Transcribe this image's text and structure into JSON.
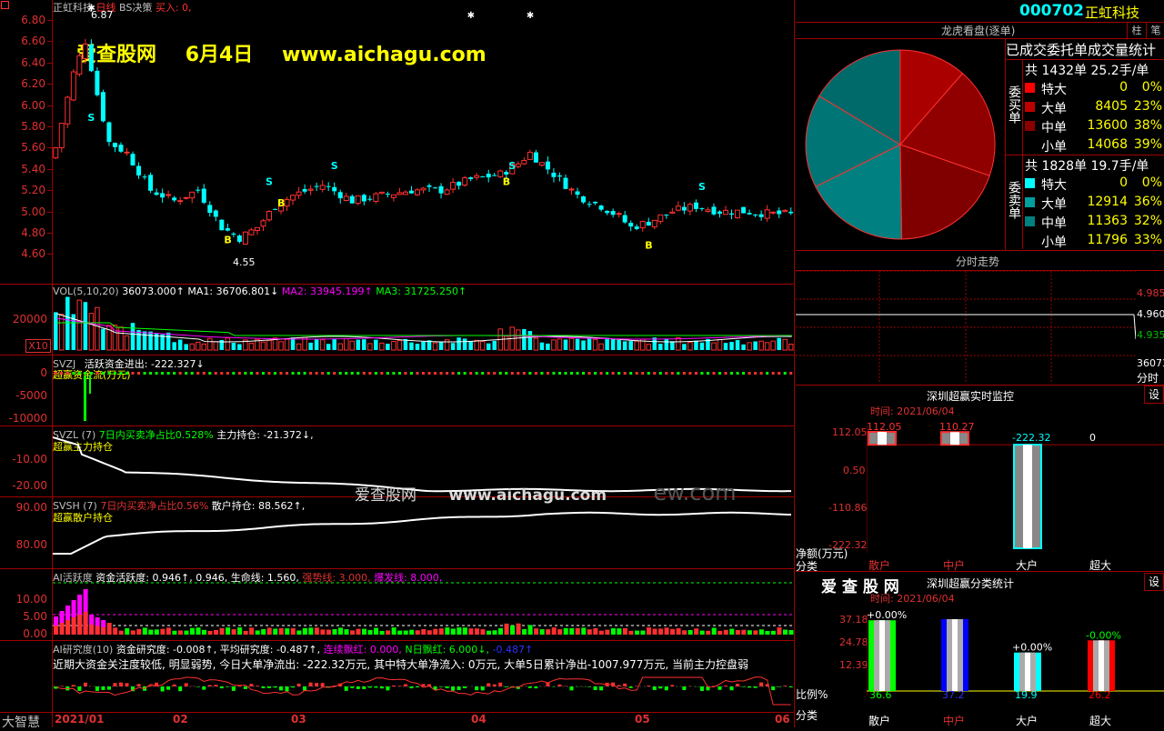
{
  "header": {
    "stock_name": "正虹科技",
    "period": "日线",
    "strategy": "BS决策",
    "signal": "买入: 0,",
    "watermark_site": "爱查股网",
    "watermark_date": "6月4日",
    "watermark_url": "www.aichagu.com"
  },
  "kline": {
    "price_ticks": [
      "6.80",
      "6.60",
      "6.40",
      "6.20",
      "6.00",
      "5.80",
      "5.60",
      "5.40",
      "5.20",
      "5.00",
      "4.80",
      "4.60"
    ],
    "high_label": "6.87",
    "low_label": "4.55"
  },
  "vol": {
    "title": "VOL(5,10,20)",
    "v": "36073.000↑",
    "ma1": "MA1: 36706.801↓",
    "ma2": "MA2: 33945.199↑",
    "ma3": "MA3: 31725.250↑",
    "tick": "20000",
    "unit": "X10"
  },
  "svzj": {
    "title": "SVZJ",
    "label": "活跃资金进出: -222.327↓",
    "sub": "超赢资金流(万元)",
    "ticks": [
      "0",
      "-5000",
      "-10000"
    ]
  },
  "svzl": {
    "title": "SVZL (7)",
    "label1": "7日内买卖净占比0.528%",
    "label2": "主力持仓: -21.372↓,",
    "sub": "超赢主力持仓",
    "ticks": [
      "-10.00",
      "-20.00"
    ],
    "wm_site": "爱查股网",
    "wm_url": "www.aichagu.com",
    "wm_ghost": "ew.com"
  },
  "svsh": {
    "title": "SVSH (7)",
    "label1": "7日内买卖净占比0.56%",
    "label2": "散户持仓: 88.562↑,",
    "sub": "超赢散户持仓",
    "ticks": [
      "90.00",
      "80.00"
    ]
  },
  "ai_active": {
    "title": "AI活跃度",
    "l1": "资金活跃度: 0.946↑,",
    "l2": "0.946,",
    "l3": "生命线: 1.560,",
    "l4": "强势线: 3.000,",
    "l5": "爆发线: 8.000,",
    "ticks": [
      "10.00",
      "5.00",
      "0.00"
    ]
  },
  "ai_research": {
    "title": "AI研究度(10)",
    "l1": "资金研究度: -0.008↑,",
    "l2": "平均研究度: -0.487↑,",
    "l3": "连续飘红: 0.000,",
    "l4": "N日飘红: 6.000↓,",
    "l5": "-0.487↑",
    "comment": "近期大资金关注度较低, 明显弱势, 今日大单净流出: -222.32万元, 其中特大单净流入: 0万元, 大单5日累计净出-1007.977万元, 当前主力控盘弱"
  },
  "xaxis": [
    "2021/01",
    "02",
    "03",
    "04",
    "05",
    "06"
  ],
  "bottom_left": "大智慧",
  "right": {
    "code": "000702",
    "name": "正虹科技",
    "btn1": "柱",
    "btn2": "笔",
    "dragon_title": "龙虎看盘(逐单)",
    "stats_title": "已成交委托单成交量统计",
    "buy_total": "共 1432单 25.2手/单",
    "sell_total": "共 1828单 19.7手/单",
    "buy_label": "委买单",
    "sell_label": "委卖单",
    "buy_rows": [
      {
        "name": "特大",
        "vol": "0",
        "pct": "0%",
        "color": "#ff0000"
      },
      {
        "name": "大单",
        "vol": "8405",
        "pct": "23%",
        "color": "#c00000"
      },
      {
        "name": "中单",
        "vol": "13600",
        "pct": "38%",
        "color": "#8c0000"
      },
      {
        "name": "小单",
        "vol": "14068",
        "pct": "39%",
        "color": "#600000"
      }
    ],
    "sell_rows": [
      {
        "name": "特大",
        "vol": "0",
        "pct": "0%",
        "color": "#00ffff"
      },
      {
        "name": "大单",
        "vol": "12914",
        "pct": "36%",
        "color": "#00a0a0"
      },
      {
        "name": "中单",
        "vol": "11363",
        "pct": "32%",
        "color": "#008080"
      },
      {
        "name": "小单",
        "vol": "11796",
        "pct": "33%",
        "color": "#006060"
      }
    ],
    "pie_slices": [
      {
        "label": "买 特大",
        "value": 0,
        "color": "#ff0000"
      },
      {
        "label": "买 大单",
        "value": 23,
        "color": "#aa0000"
      },
      {
        "label": "买 中单",
        "value": 38,
        "color": "#900000"
      },
      {
        "label": "买 小单",
        "value": 39,
        "color": "#800000"
      },
      {
        "label": "卖 特大",
        "value": 0,
        "color": "#00ffff"
      },
      {
        "label": "卖 大单",
        "value": 36,
        "color": "#008080"
      },
      {
        "label": "卖 中单",
        "value": 32,
        "color": "#007575"
      },
      {
        "label": "卖 小单",
        "value": 33,
        "color": "#006a6a"
      }
    ],
    "intraday_title": "分时走势",
    "intraday_ticks": [
      "4.985",
      "4.960",
      "4.935"
    ],
    "intraday_vol": "36073",
    "intraday_label": "分时",
    "monitor_title": "深圳超赢实时监控",
    "monitor_btn": "设",
    "monitor_time": "时间: 2021/06/04",
    "monitor_ticks": [
      "112.05",
      "0.50",
      "-110.86",
      "-222.32"
    ],
    "monitor_values": [
      "112.05",
      "110.27",
      "-222.32",
      "0"
    ],
    "monitor_unit": "净额(万元)",
    "monitor_cat_label": "分类",
    "categories": [
      "散户",
      "中户",
      "大户",
      "超大"
    ],
    "class_site": "爱 查 股 网",
    "class_title": "深圳超赢分类统计",
    "class_btn": "设",
    "class_time": "时间: 2021/06/04",
    "class_ticks": [
      "37.18",
      "24.78",
      "12.39"
    ],
    "class_changes": [
      "+0.00%",
      "",
      "+0.00%",
      "-0.00%"
    ],
    "class_values": [
      "36.6",
      "37.2",
      "19.9",
      "26.2"
    ],
    "class_ratio_label": "比例%",
    "class_cat_label": "分类",
    "chart_data": [
      {
        "type": "bar",
        "title": "深圳超赢实时监控",
        "ylabel": "净额(万元)",
        "categories": [
          "散户",
          "中户",
          "大户",
          "超大"
        ],
        "values": [
          112.05,
          110.27,
          -222.32,
          0
        ],
        "ylim": [
          -222.32,
          112.05
        ]
      },
      {
        "type": "bar",
        "title": "深圳超赢分类统计",
        "ylabel": "比例%",
        "categories": [
          "散户",
          "中户",
          "大户",
          "超大"
        ],
        "values": [
          36.6,
          37.2,
          19.9,
          26.2
        ],
        "ylim": [
          0,
          37.18
        ]
      }
    ]
  }
}
